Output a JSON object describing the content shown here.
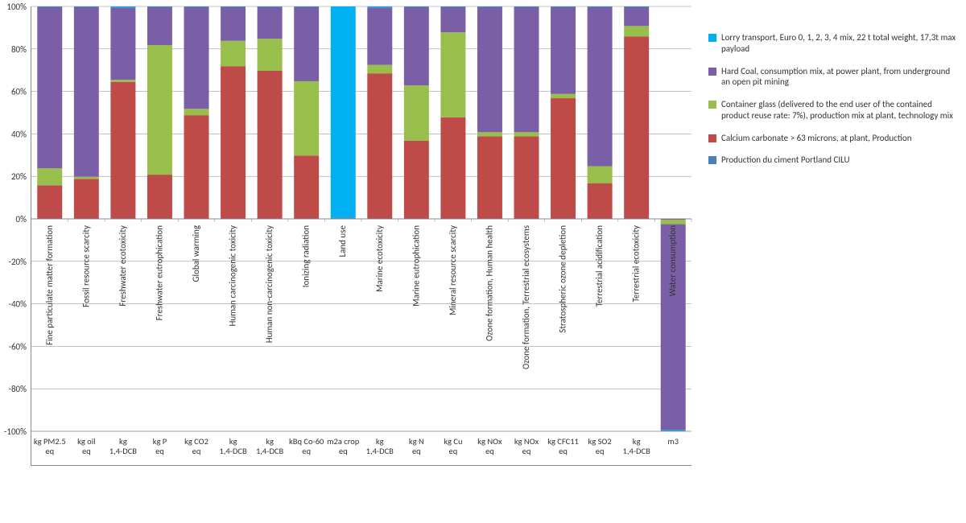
{
  "chart_data": {
    "type": "bar",
    "stacked": true,
    "normalized_percent": true,
    "ylim": [
      -100,
      100
    ],
    "yticks": [
      -100,
      -80,
      -60,
      -40,
      -20,
      0,
      20,
      40,
      60,
      80,
      100
    ],
    "ytick_labels": [
      "-100%",
      "-80%",
      "-60%",
      "-40%",
      "-20%",
      "0%",
      "20%",
      "40%",
      "60%",
      "80%",
      "100%"
    ],
    "categories": [
      "Fine particulate matter formation",
      "Fossil resource scarcity",
      "Freshwater ecotoxicity",
      "Freshwater eutrophication",
      "Global warming",
      "Human carcinogenic toxicity",
      "Human non-carcinogenic toxicity",
      "Ionizing radiation",
      "Land use",
      "Marine ecotoxicity",
      "Marine eutrophication",
      "Mineral resource scarcity",
      "Ozone formation, Human health",
      "Ozone formation, Terrestrial ecosystems",
      "Stratospheric ozone depletion",
      "Terrestrial acidification",
      "Terrestrial ecotoxicity",
      "Water consumption"
    ],
    "units": [
      "kg PM2.5 eq",
      "kg oil eq",
      "kg 1,4-DCB",
      "kg P eq",
      "kg CO2 eq",
      "kg 1,4-DCB",
      "kg 1,4-DCB",
      "kBq Co-60 eq",
      "m2a crop eq",
      "kg 1,4-DCB",
      "kg N eq",
      "kg Cu eq",
      "kg NOx eq",
      "kg NOx eq",
      "kg CFC11 eq",
      "kg SO2 eq",
      "kg 1,4-DCB",
      "m3"
    ],
    "series": [
      {
        "name": "Lorry transport, Euro 0, 1, 2, 3, 4 mix, 22 t total weight, 17,3t max payload",
        "color": "#00B0F0",
        "values": [
          0.2,
          0.2,
          0.5,
          0.2,
          0.2,
          0.2,
          0.2,
          0.2,
          99.6,
          0.5,
          0.2,
          0.2,
          0.2,
          0.2,
          0.2,
          0.2,
          0.2,
          -0.5
        ]
      },
      {
        "name": "Hard Coal, consumption mix, at power plant, from underground an open pit mining",
        "color": "#7A5FA6",
        "values": [
          76,
          80,
          34,
          18,
          48,
          16,
          15,
          35,
          0.2,
          27,
          37,
          12,
          59,
          59,
          41,
          75,
          9,
          -97
        ]
      },
      {
        "name": "Container glass (delivered to the end user of the contained product reuse rate: 7%), production mix at plant, technology mix",
        "color": "#98BE4B",
        "values": [
          8,
          1,
          1,
          61,
          3,
          12,
          15,
          35,
          0.1,
          4,
          26,
          40,
          2,
          2,
          2,
          8,
          5,
          -2
        ]
      },
      {
        "name": "Calcium carbonate > 63 microns, at plant, Production",
        "color": "#BE4B48",
        "values": [
          15.6,
          18.6,
          64.3,
          20.6,
          48.6,
          71.6,
          69.6,
          29.6,
          0.05,
          68.3,
          36.6,
          47.6,
          38.6,
          38.6,
          56.6,
          16.6,
          85.6,
          -0.3
        ]
      },
      {
        "name": "Production du ciment Portland CILU",
        "color": "#4A7FBC",
        "values": [
          0.2,
          0.2,
          0.2,
          0.2,
          0.2,
          0.2,
          0.2,
          0.2,
          0.05,
          0.2,
          0.2,
          0.2,
          0.2,
          0.2,
          0.2,
          0.2,
          0.2,
          -0.2
        ]
      }
    ]
  },
  "legend": {
    "items": [
      "Lorry transport, Euro 0, 1, 2, 3, 4 mix, 22 t total weight, 17,3t max payload",
      "Hard Coal, consumption mix, at power plant, from underground an open pit mining",
      "Container glass (delivered to the end user of the contained product reuse rate: 7%), production mix at plant, technology mix",
      "Calcium carbonate > 63 microns, at plant, Production",
      "Production du ciment Portland CILU"
    ]
  }
}
